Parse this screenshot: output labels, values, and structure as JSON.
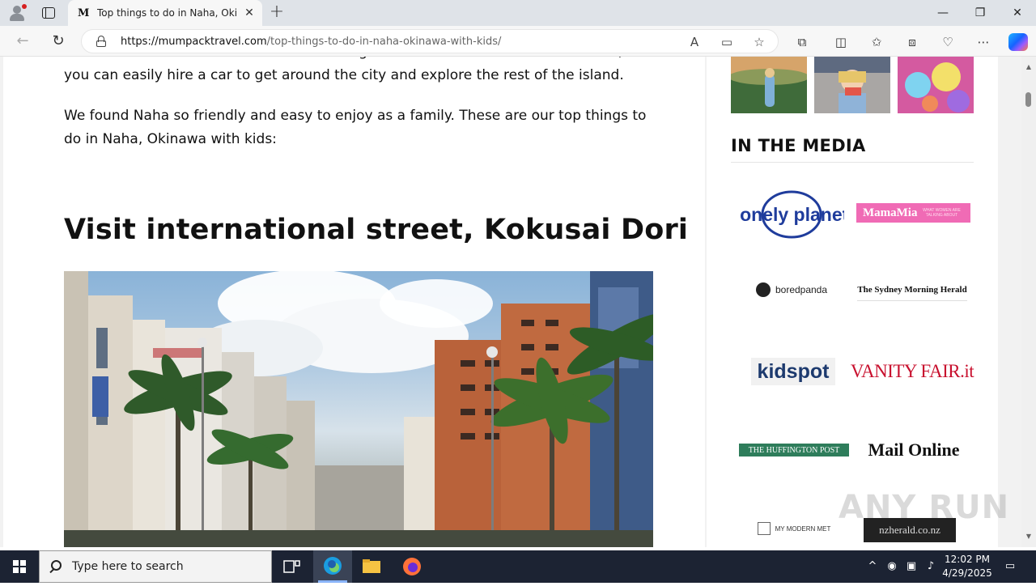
{
  "browser": {
    "tab_title": "Top things to do in Naha, Okinawa with kids",
    "tab_favicon": "M",
    "url_domain": "https://mumpacktravel.com",
    "url_path": "/top-things-to-do-in-naha-okinawa-with-kids/"
  },
  "article": {
    "para_cut": "which is Naha's hub. Some of the best things to see in Naha will need a taxi ride, or you can easily hire a car to get around the city and explore the rest of the island.",
    "para_2": "We found Naha so friendly and easy to enjoy as a family. These are our top things to do in Naha, Okinawa with kids:",
    "section_heading": "Visit international street, Kokusai Dori"
  },
  "sidebar": {
    "media_heading": "IN THE MEDIA",
    "logos": [
      "lonely planet",
      "MamaMia",
      "WHAT WOMEN ARE TALKING ABOUT",
      "boredpanda",
      "The Sydney Morning Herald",
      "kidspot",
      "VANITY FAIR.it",
      "THE HUFFINGTON POST",
      "Mail Online",
      "MY MODERN MET",
      "nzherald.co.nz"
    ]
  },
  "watermark": "ANY RUN",
  "taskbar": {
    "search_placeholder": "Type here to search",
    "time": "12:02 PM",
    "date": "4/29/2025"
  },
  "colors": {
    "taskbar_bg": "#1c2333",
    "tab_bar_bg": "#dfe3e8",
    "lonely_planet_blue": "#1f3c9c",
    "mamamia_pink": "#f06bb5",
    "vanity_fair_red": "#c8102e",
    "huffington_green": "#2e7d5b"
  }
}
